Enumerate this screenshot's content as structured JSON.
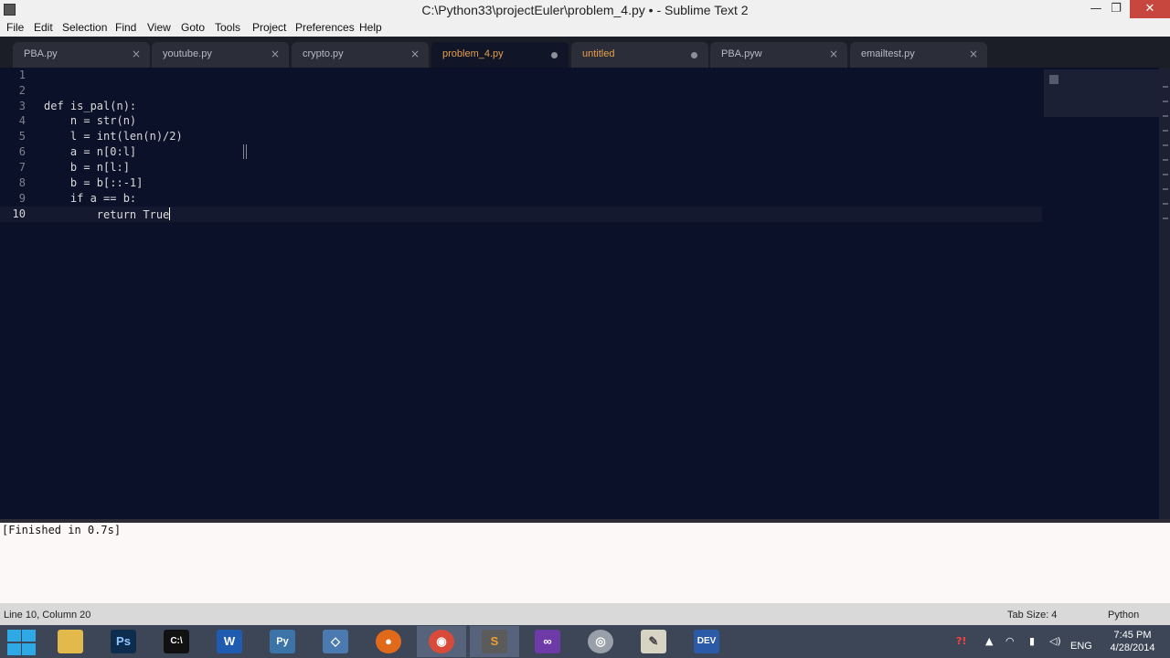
{
  "window": {
    "title": "C:\\Python33\\projectEuler\\problem_4.py • - Sublime Text 2",
    "minimize_glyph": "—",
    "restore_glyph": "❐",
    "close_glyph": "✕"
  },
  "menu": {
    "items": [
      "File",
      "Edit",
      "Selection",
      "Find",
      "View",
      "Goto",
      "Tools",
      "Project",
      "Preferences",
      "Help"
    ]
  },
  "tabs": [
    {
      "label": "PBA.py",
      "state": "clean"
    },
    {
      "label": "youtube.py",
      "state": "clean"
    },
    {
      "label": "crypto.py",
      "state": "clean"
    },
    {
      "label": "problem_4.py",
      "state": "active-dirty"
    },
    {
      "label": "untitled",
      "state": "dirty"
    },
    {
      "label": "PBA.pyw",
      "state": "clean"
    },
    {
      "label": "emailtest.py",
      "state": "clean"
    }
  ],
  "tab_close_glyph": "×",
  "editor": {
    "line_numbers": [
      "1",
      "2",
      "3",
      "4",
      "5",
      "6",
      "7",
      "8",
      "9",
      "10"
    ],
    "current_line": "10",
    "lines": [
      "",
      "",
      "def is_pal(n):",
      "    n = str(n)",
      "    l = int(len(n)/2)",
      "    a = n[0:l]",
      "    b = n[l:]",
      "    b = b[::-1]",
      "    if a == b:",
      "        return True"
    ]
  },
  "output": {
    "text": "[Finished in 0.7s]"
  },
  "status": {
    "position": "Line 10, Column 20",
    "tab_size": "Tab Size: 4",
    "syntax": "Python"
  },
  "taskbar": {
    "apps": [
      {
        "name": "file-explorer-icon",
        "glyph": "",
        "color": "#e2b94a"
      },
      {
        "name": "photoshop-icon",
        "glyph": "Ps",
        "color": "#0e2c4d"
      },
      {
        "name": "command-prompt-icon",
        "glyph": "C:\\",
        "color": "#111111"
      },
      {
        "name": "word-icon",
        "glyph": "W",
        "color": "#1f5bb0"
      },
      {
        "name": "python-icon",
        "glyph": "Py",
        "color": "#3c74a8"
      },
      {
        "name": "editor-icon",
        "glyph": "◇",
        "color": "#4a7ab0"
      },
      {
        "name": "firefox-icon",
        "glyph": "●",
        "color": "#e06a1a"
      },
      {
        "name": "chrome-icon",
        "glyph": "◉",
        "color": "#d84b3b"
      },
      {
        "name": "sublime-text-icon",
        "glyph": "S",
        "color": "#5b5b5b"
      },
      {
        "name": "visual-studio-icon",
        "glyph": "∞",
        "color": "#6e3aa8"
      },
      {
        "name": "media-icon",
        "glyph": "◎",
        "color": "#9aa0aa"
      },
      {
        "name": "notepad-icon",
        "glyph": "✎",
        "color": "#d8d4c4"
      },
      {
        "name": "dev-cpp-icon",
        "glyph": "DEV",
        "color": "#2a5aa8"
      }
    ],
    "tray": {
      "language": "ENG",
      "time": "7:45 PM",
      "date": "4/28/2014"
    }
  },
  "colors": {
    "editor_bg": "#0b1128",
    "active_tab_text": "#e8a04a",
    "taskbar_bg": "#3c4656"
  }
}
